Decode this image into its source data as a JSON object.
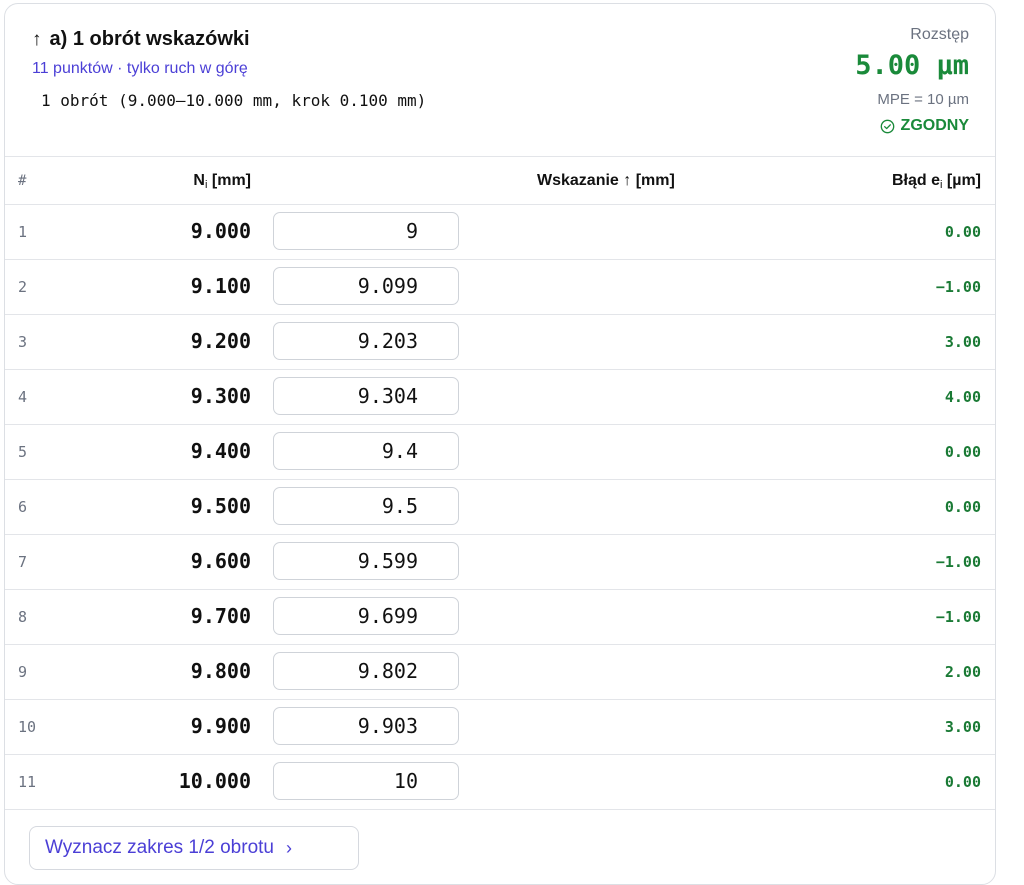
{
  "header": {
    "arrow_glyph": "↑",
    "title": "a) 1 obrót wskazówki",
    "subtitle": "11 punktów · tylko ruch w górę",
    "meta": "1 obrót (9.000–10.000 mm, krok 0.100 mm)",
    "range_label": "Rozstęp",
    "range_value": "5.00 µm",
    "mpe": "MPE = 10 µm",
    "status": "ZGODNY"
  },
  "colors": {
    "accent": "#4b3fd6",
    "ok": "#1a8a3a",
    "muted": "#6b7280"
  },
  "table": {
    "col_num": "#",
    "col_ni_main": "N",
    "col_ni_sub": "i",
    "col_ni_unit": " [mm]",
    "col_wsk": "Wskazanie ↑ [mm]",
    "col_err_main": "Błąd e",
    "col_err_sub": "i",
    "col_err_unit": " [µm]",
    "rows": [
      {
        "num": "1",
        "ni": "9.000",
        "value": "9",
        "err": "0.00"
      },
      {
        "num": "2",
        "ni": "9.100",
        "value": "9.099",
        "err": "−1.00"
      },
      {
        "num": "3",
        "ni": "9.200",
        "value": "9.203",
        "err": "3.00"
      },
      {
        "num": "4",
        "ni": "9.300",
        "value": "9.304",
        "err": "4.00"
      },
      {
        "num": "5",
        "ni": "9.400",
        "value": "9.4",
        "err": "0.00"
      },
      {
        "num": "6",
        "ni": "9.500",
        "value": "9.5",
        "err": "0.00"
      },
      {
        "num": "7",
        "ni": "9.600",
        "value": "9.599",
        "err": "−1.00"
      },
      {
        "num": "8",
        "ni": "9.700",
        "value": "9.699",
        "err": "−1.00"
      },
      {
        "num": "9",
        "ni": "9.800",
        "value": "9.802",
        "err": "2.00"
      },
      {
        "num": "10",
        "ni": "9.900",
        "value": "9.903",
        "err": "3.00"
      },
      {
        "num": "11",
        "ni": "10.000",
        "value": "10",
        "err": "0.00"
      }
    ]
  },
  "footer": {
    "button_label": "Wyznacz zakres 1/2 obrotu",
    "button_chevron": "›"
  }
}
